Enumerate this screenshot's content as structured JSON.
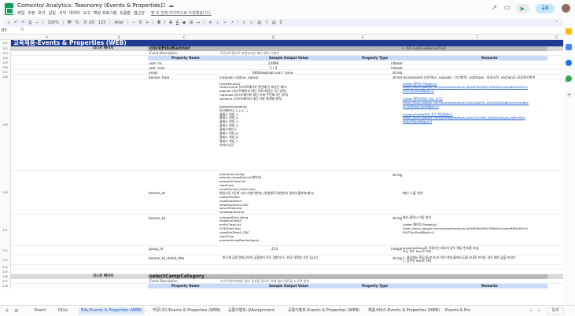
{
  "app": {
    "doc_title": "Comento/ Analytics: Taxonomy (Events & Properties)",
    "last_edit": "몇 초 전에 마지막으로 수정했습니다.",
    "menus": [
      "파일",
      "수정",
      "보기",
      "삽입",
      "서식",
      "데이터",
      "도구",
      "확장 프로그램",
      "도움말",
      "접근성"
    ],
    "share_label": "공유"
  },
  "toolbar": {
    "zoom": "100%",
    "currency": "₩",
    "percent": "%",
    "decimals": ".0  .00",
    "num_format": "123",
    "font": "Arial",
    "font_size": "6",
    "bold": "B",
    "italic": "I",
    "strike": "S",
    "text_color": "A"
  },
  "formula_bar": {
    "cell_ref": "B3",
    "fx": "fx"
  },
  "columns": [
    "A",
    "B",
    "C",
    "D",
    "E",
    "F",
    "G"
  ],
  "rows": {
    "r101": {
      "num": "101",
      "banner": "교육제품-Events & Properties (WEB)"
    },
    "r102": {
      "num": "102",
      "label": "리스트 페이지",
      "name": "clickEduBanner",
      "note": "> 기존 readCaseBannerClick"
    },
    "r103": {
      "num": "103",
      "desc_label": "Event Description:",
      "desc": "직무부트캠프로 포함되어온 배너 클릭 이벤트"
    },
    "r104": {
      "num": "104",
      "h1": "Property Name",
      "h2": "Sample Output Value",
      "h3": "Property Type",
      "h4": "Remarks"
    },
    "r105": {
      "num": "105",
      "name": "user_no",
      "value": "23890",
      "type": "integer"
    },
    "r106": {
      "num": "106",
      "name": "user_type",
      "value": "1 / 2",
      "type": "integer"
    },
    "r107": {
      "num": "107",
      "name": "email",
      "value": "0000@gmail.com / none",
      "type": "string"
    },
    "r108": {
      "num": "108",
      "name": "banner_type",
      "value": "carousel, native, popup",
      "type": "string",
      "remark": "recommend (리던에스, popular : 인기항목, rightnow : 마감시작, section3: 모집중인항목"
    },
    "r109": {
      "num": "109",
      "value": "[viewEduList]\nrecommend (리스트페이지 첫번째 탄 최상단 배너)\npopular (리스트페이지 대단 아래 최상단 3단 영역)\nrightnow (리스트페이지 대단 아래 두번째 3단 영역)\nsection3 (리스트페이지 대단 아래 세번째 영역)\n\n[onboardLanding]\n모인페이지 (1,2,3...)\n클래스 섹션_1\n클래스 섹션_2\n클래스 섹션_3\n클래스 섹션_4\n클래스섹션 5\n클래스 섹션_6\n클래스 섹션_8\n클래스 섹션_7\n커리어고민",
      "remark": "[index 페이지 Property]\nhttps://docs.google.com/spreadsheets/d/1q5sM9bqSW/Cl9fbQkxnwqht6ZtmAYUm\n9VJTSzuSedtI8gid=0\n\n[index 페이지에서 CBC 추가]\nhttps://docs.google.com/spreadsheets/d/1HN2GtkDYjL-deSGWW5b8jMuxEnhm6wc\nIu7z0tDBK1IodtI8gid=0\n\n[updateProfile에서 추가 랜딩클래스]\nhttps://docs.google.com/spreadsheets/d/1a4xZGk34kd_KqXtKv5bsyA-xWPcrRe4\nKWoZI8eddI8gid=0"
    },
    "r110": {
      "num": "110",
      "name": "banner_at",
      "value": "onboardLanding\neduList (viewEduList 페이지)\nonboardClassList\nreadCase\nviewEduList_onAirClass\n회원가입 3단계 (자소서봉이번에) (현업멘토오현현보) 클래스출판회(메시)\nupdateProfile\nviewEduDetail\nviewEduDetail-CBC\nsearchRequest\nviewRequestList",
      "type": "string",
      "remark": "배너 노출 위치"
    },
    "r111": {
      "num": "111",
      "name": "banner_to",
      "value": "onboardEduListing\nviewEduDetail\nonAirClassList\nVODFreeClass\nviewEduDetail_CBC\nreadCase\nonboardLeadMentorApply",
      "type": "string",
      "remark": "배너 클릭시 이동 위치\n\n[index 페이지 Property]\nhttps://docs.google.com/spreadsheets/d/1q5sM9bqSW/Cl9fbQkxnwqht6ZtmAYUm\n9VJTSzuSedtI8gid=0"
    },
    "r112": {
      "num": "112",
      "name": "group_id",
      "value": "214",
      "type": "integer",
      "remark": "viewEduDetail로 이동하는 배너의 경우 해당 번호를 보냄,\n아닌 경우 Null로 처리"
    },
    "r113": {
      "num": "113",
      "name": "banner_to_detail_title",
      "value": "반도체 공정 엔지니어의 공정관리 직무 경험하기 / 외국 대학원 고민 입니다",
      "type": "string",
      "remark": "1. 클립에서 중단/뒤(추가)가 이미 엔지/클래스/담당사내로 보내는 경우 배치 값을 보내기\n2. 없으면 Null로 처리"
    },
    "r114": {
      "num": "114"
    },
    "r115": {
      "num": "115"
    },
    "r116": {
      "num": "116",
      "label": "리스트 페이지",
      "name": "selectCampCategory"
    },
    "r117": {
      "num": "117",
      "desc_label": "Event Description:",
      "desc": "리스트페이지에서 필터 옵션을 클릭가 위해 필터 버튼을 누르면 발생"
    },
    "r118": {
      "num": "118",
      "h1": "Property Name",
      "h2": "Sample Output Value",
      "h3": "Property Type",
      "h4": "Remarks"
    }
  },
  "tabs": {
    "items": [
      "Event",
      "DLVs",
      "Edu-Events & Properties (WEB)",
      "커뮤니티-Events & Properties (WEB)",
      "공통이벤트-교Assignment",
      "공통이벤트-Events & Properties (WEB)",
      "채용서비스-Events & Properties (WEB)",
      "Events & Pro"
    ],
    "active_index": 2,
    "explore_label": "탐색"
  },
  "colors": {
    "banner": "#1f3a93",
    "section_band": "#d9d9d9",
    "section_dark": "#b7b7b7",
    "header_row": "#c9daf8",
    "share": "#c2e7ff",
    "sheets_green": "#0f9d58"
  }
}
